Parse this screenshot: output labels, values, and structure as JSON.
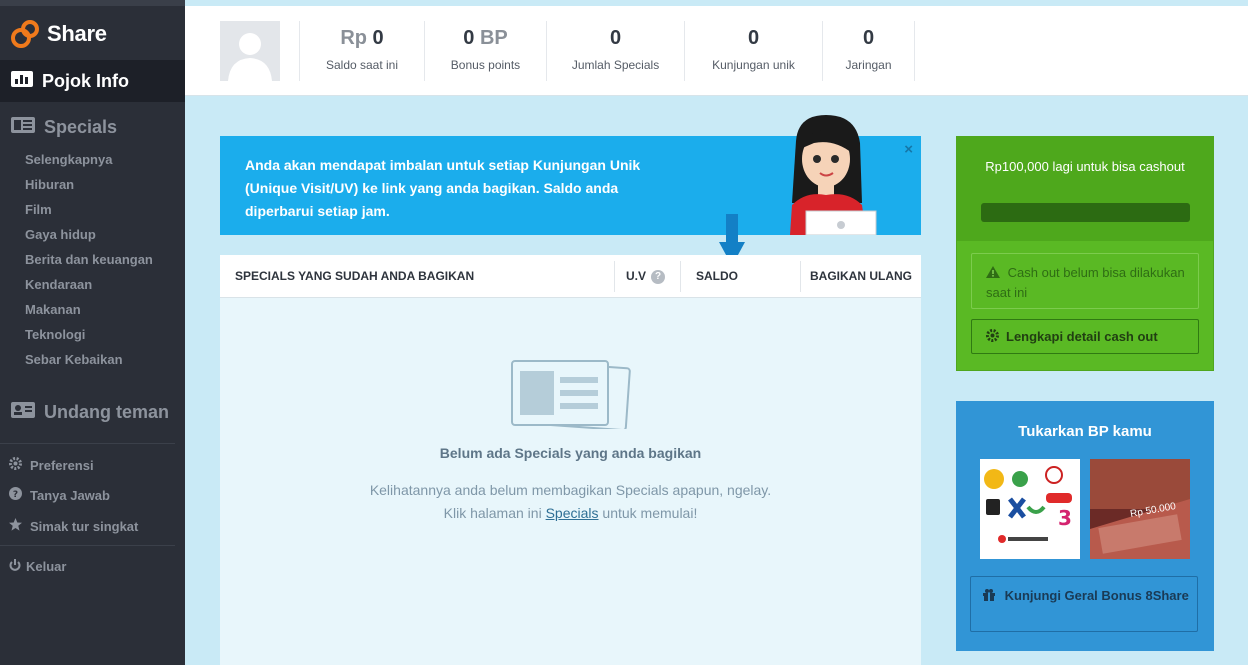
{
  "sidebar": {
    "logo_text": "Share",
    "active_item": "Pojok Info",
    "specials_heading": "Specials",
    "specials_items": [
      "Selengkapnya",
      "Hiburan",
      "Film",
      "Gaya hidup",
      "Berita dan keuangan",
      "Kendaraan",
      "Makanan",
      "Teknologi",
      "Sebar Kebaikan"
    ],
    "invite_heading": "Undang teman",
    "secondary_items": [
      {
        "label": "Preferensi",
        "icon": "gear-icon"
      },
      {
        "label": "Tanya Jawab",
        "icon": "question-icon"
      },
      {
        "label": "Simak tur singkat",
        "icon": "star-icon"
      }
    ],
    "logout_label": "Keluar"
  },
  "stats": [
    {
      "value": "0",
      "unit": "Rp",
      "label": "Saldo saat ini"
    },
    {
      "value": "0",
      "unit": "BP",
      "label": "Bonus points"
    },
    {
      "value": "0",
      "unit": "",
      "label": "Jumlah Specials"
    },
    {
      "value": "0",
      "unit": "",
      "label": "Kunjungan unik"
    },
    {
      "value": "0",
      "unit": "",
      "label": "Jaringan"
    }
  ],
  "banner": {
    "text": "Anda akan mendapat imbalan untuk setiap Kunjungan Unik (Unique Visit/UV) ke link yang anda bagikan. Saldo anda diperbarui setiap jam.",
    "close": "×"
  },
  "table": {
    "col_specials": "SPECIALS YANG SUDAH ANDA BAGIKAN",
    "col_uv": "U.V",
    "col_uv_help": "?",
    "col_saldo": "SALDO",
    "col_share": "BAGIKAN ULANG",
    "empty_title": "Belum ada Specials yang anda bagikan",
    "empty_line1": "Kelihatannya anda belum membagikan Specials apapun, ngelay.",
    "empty_line2_pre": "Klik halaman ini",
    "empty_link": "Specials",
    "empty_line2_post": "untuk memulai!"
  },
  "cashout": {
    "need_text": "Rp100,000 lagi untuk bisa cashout",
    "progress": 0,
    "warning": "Cash out belum bisa dilakukan saat ini",
    "detail_button": "Lengkapi detail cash out"
  },
  "bp": {
    "title": "Tukarkan BP kamu",
    "voucher_text": "Rp 50.000",
    "button": "Kunjungi Geral Bonus 8Share"
  },
  "colors": {
    "sidebar_bg": "#2b2f38",
    "banner": "#1badec",
    "cashout_green": "#5ab924",
    "bp_blue": "#3195d6"
  }
}
